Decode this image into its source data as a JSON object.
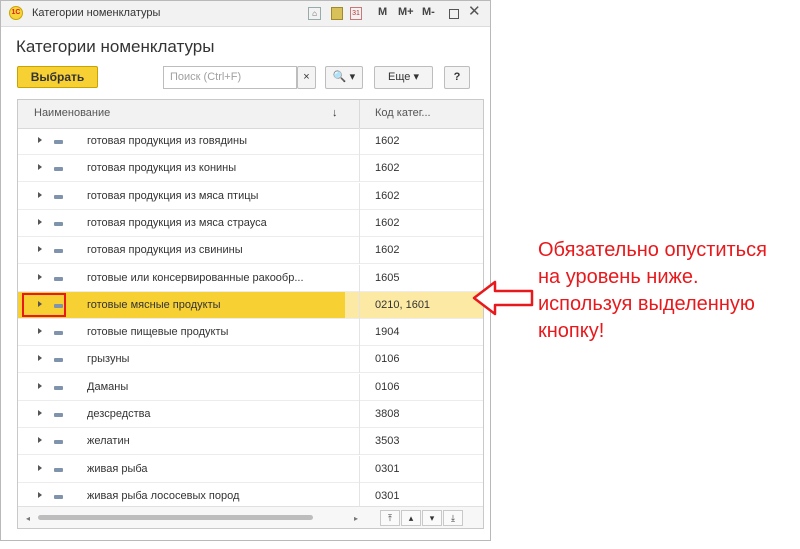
{
  "window": {
    "title": "Категории номенклатуры",
    "logo_text": "1С",
    "toolbar_m": "M",
    "toolbar_mplus": "M+",
    "toolbar_mminus": "M-"
  },
  "form": {
    "heading": "Категории номенклатуры",
    "select_label": "Выбрать",
    "search_placeholder": "Поиск (Ctrl+F)",
    "clear_label": "×",
    "search_label": "🔍 ▾",
    "more_label": "Еще ▾",
    "help_label": "?"
  },
  "table": {
    "columns": [
      "Наименование",
      "Код катег..."
    ],
    "sort_indicator": "↓",
    "rows": [
      {
        "name": "готовая продукция из говядины",
        "code": "1602"
      },
      {
        "name": "готовая продукция из конины",
        "code": "1602"
      },
      {
        "name": "готовая продукция из мяса птицы",
        "code": "1602"
      },
      {
        "name": "готовая продукция из мяса страуса",
        "code": "1602"
      },
      {
        "name": "готовая продукция из свинины",
        "code": "1602"
      },
      {
        "name": "готовые или консервированные ракообр...",
        "code": "1605"
      },
      {
        "name": "готовые мясные продукты",
        "code": "0210, 1601",
        "selected": true
      },
      {
        "name": "готовые пищевые продукты",
        "code": "1904"
      },
      {
        "name": "грызуны",
        "code": "0106"
      },
      {
        "name": "Даманы",
        "code": "0106"
      },
      {
        "name": "дезсредства",
        "code": "3808"
      },
      {
        "name": "желатин",
        "code": "3503"
      },
      {
        "name": "живая рыба",
        "code": "0301"
      },
      {
        "name": "живая рыба лососевых пород",
        "code": "0301"
      }
    ]
  },
  "annotation": {
    "text": "Обязательно опуститься на уровень ниже. используя выделенную кнопку!",
    "color": "#e8191c"
  },
  "colors": {
    "accent": "#f7d034",
    "selected_row": "#fbe9a4"
  }
}
